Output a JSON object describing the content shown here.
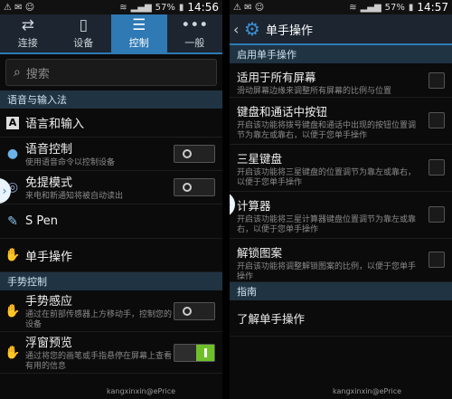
{
  "left": {
    "status": {
      "signal_icons": "⚠ ✉ ☺",
      "battery": "57%",
      "time": "14:56"
    },
    "tabs": [
      {
        "label": "连接",
        "icon": "connect-icon"
      },
      {
        "label": "设备",
        "icon": "device-icon"
      },
      {
        "label": "控制",
        "icon": "control-icon",
        "active": true
      },
      {
        "label": "一般",
        "icon": "more-icon"
      }
    ],
    "search": {
      "placeholder": "搜索"
    },
    "sections": {
      "language": "语音与输入法",
      "gesture": "手势控制"
    },
    "items": {
      "lang_input": {
        "title": "语言和输入"
      },
      "voice": {
        "title": "语音控制",
        "sub": "使用语音命令以控制设备",
        "toggle": "off"
      },
      "handsfree": {
        "title": "免提模式",
        "sub": "来电和新通知将被自动读出",
        "toggle": "off"
      },
      "spen": {
        "title": "S Pen"
      },
      "onehand": {
        "title": "单手操作"
      },
      "gesture_sense": {
        "title": "手势感应",
        "sub": "通过在前部传感器上方移动手，控制您的设备",
        "toggle": "off"
      },
      "float_preview": {
        "title": "浮窗预览",
        "sub": "通过将您的画笔或手指悬停在屏幕上查看有用的信息",
        "toggle": "on"
      }
    },
    "watermark": "kangxinxin@ePrice"
  },
  "right": {
    "status": {
      "signal_icons": "⚠ ✉ ☺",
      "battery": "57%",
      "time": "14:57"
    },
    "header": {
      "title": "单手操作"
    },
    "sections": {
      "enable": "启用单手操作",
      "guide": "指南"
    },
    "items": {
      "all_screens": {
        "title": "适用于所有屏幕",
        "sub": "滑动屏幕边缘来调整所有屏幕的比例与位置"
      },
      "keypad_call": {
        "title": "键盘和通话中按钮",
        "sub": "开启该功能将拨号键盘和通话中出现的按钮位置调节为靠左或靠右，以便于您单手操作"
      },
      "samsung_kb": {
        "title": "三星键盘",
        "sub": "开启该功能将三星键盘的位置调节为靠左或靠右，以便于您单手操作"
      },
      "calculator": {
        "title": "计算器",
        "sub": "开启该功能将三星计算器键盘位置调节为靠左或靠右，以便于您单手操作"
      },
      "unlock": {
        "title": "解锁图案",
        "sub": "开启该功能将调整解锁图案的比例，以便于您单手操作"
      },
      "learn": {
        "title": "了解单手操作"
      }
    },
    "watermark": "kangxinxin@ePrice"
  },
  "colors": {
    "accent": "#2f79b4",
    "section_bg": "#1f3342",
    "toggle_on": "#6fbf2b"
  }
}
